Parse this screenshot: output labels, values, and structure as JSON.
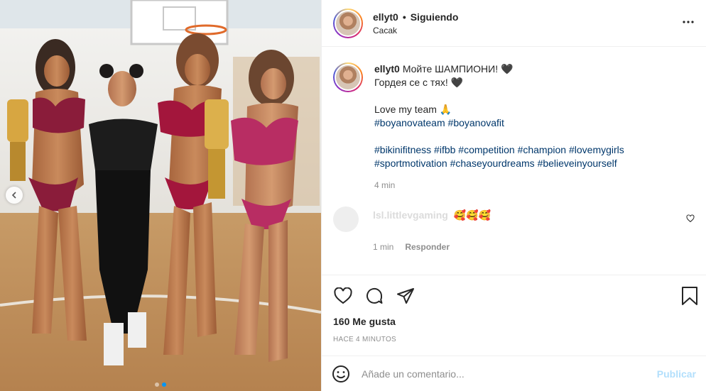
{
  "post": {
    "username": "ellyt0",
    "separator": "•",
    "follow_status": "Siguiendo",
    "location": "Cacak",
    "more_icon": "more-horizontal-icon",
    "photo_alt": "Cuatro mujeres posando con trofeos y medallas en un gimnasio",
    "carousel": {
      "current": 1,
      "total": 2
    }
  },
  "caption": {
    "username": "ellyt0",
    "line1": "Мойте ШАМПИОНИ! 🖤",
    "line2": "Гордея се с тях! 🖤",
    "line3": "Love my team 🙏",
    "hashtags_line1": [
      "#boyanovateam",
      "#boyanovafit"
    ],
    "hashtags_line2": [
      "#bikinifitness",
      "#ifbb",
      "#competition",
      "#champion",
      "#lovemygirls"
    ],
    "hashtags_line3": [
      "#sportmotivation",
      "#chaseyourdreams",
      "#believeinyourself"
    ],
    "time": "4 min"
  },
  "comment": {
    "username": "lsl.littlevgaming",
    "text": "🥰🥰🥰",
    "time": "1 min",
    "reply_label": "Responder"
  },
  "actions": {
    "like_icon": "heart-icon",
    "comment_icon": "comment-icon",
    "share_icon": "send-icon",
    "save_icon": "bookmark-icon"
  },
  "stats": {
    "likes": "160 Me gusta",
    "posted_ago": "HACE 4 MINUTOS"
  },
  "add_comment": {
    "placeholder": "Añade un comentario...",
    "publish_label": "Publicar"
  },
  "colors": {
    "link": "#00376b",
    "muted": "#8e8e8e",
    "publish_disabled": "#b2dffc",
    "active_dot": "#0095f6"
  }
}
